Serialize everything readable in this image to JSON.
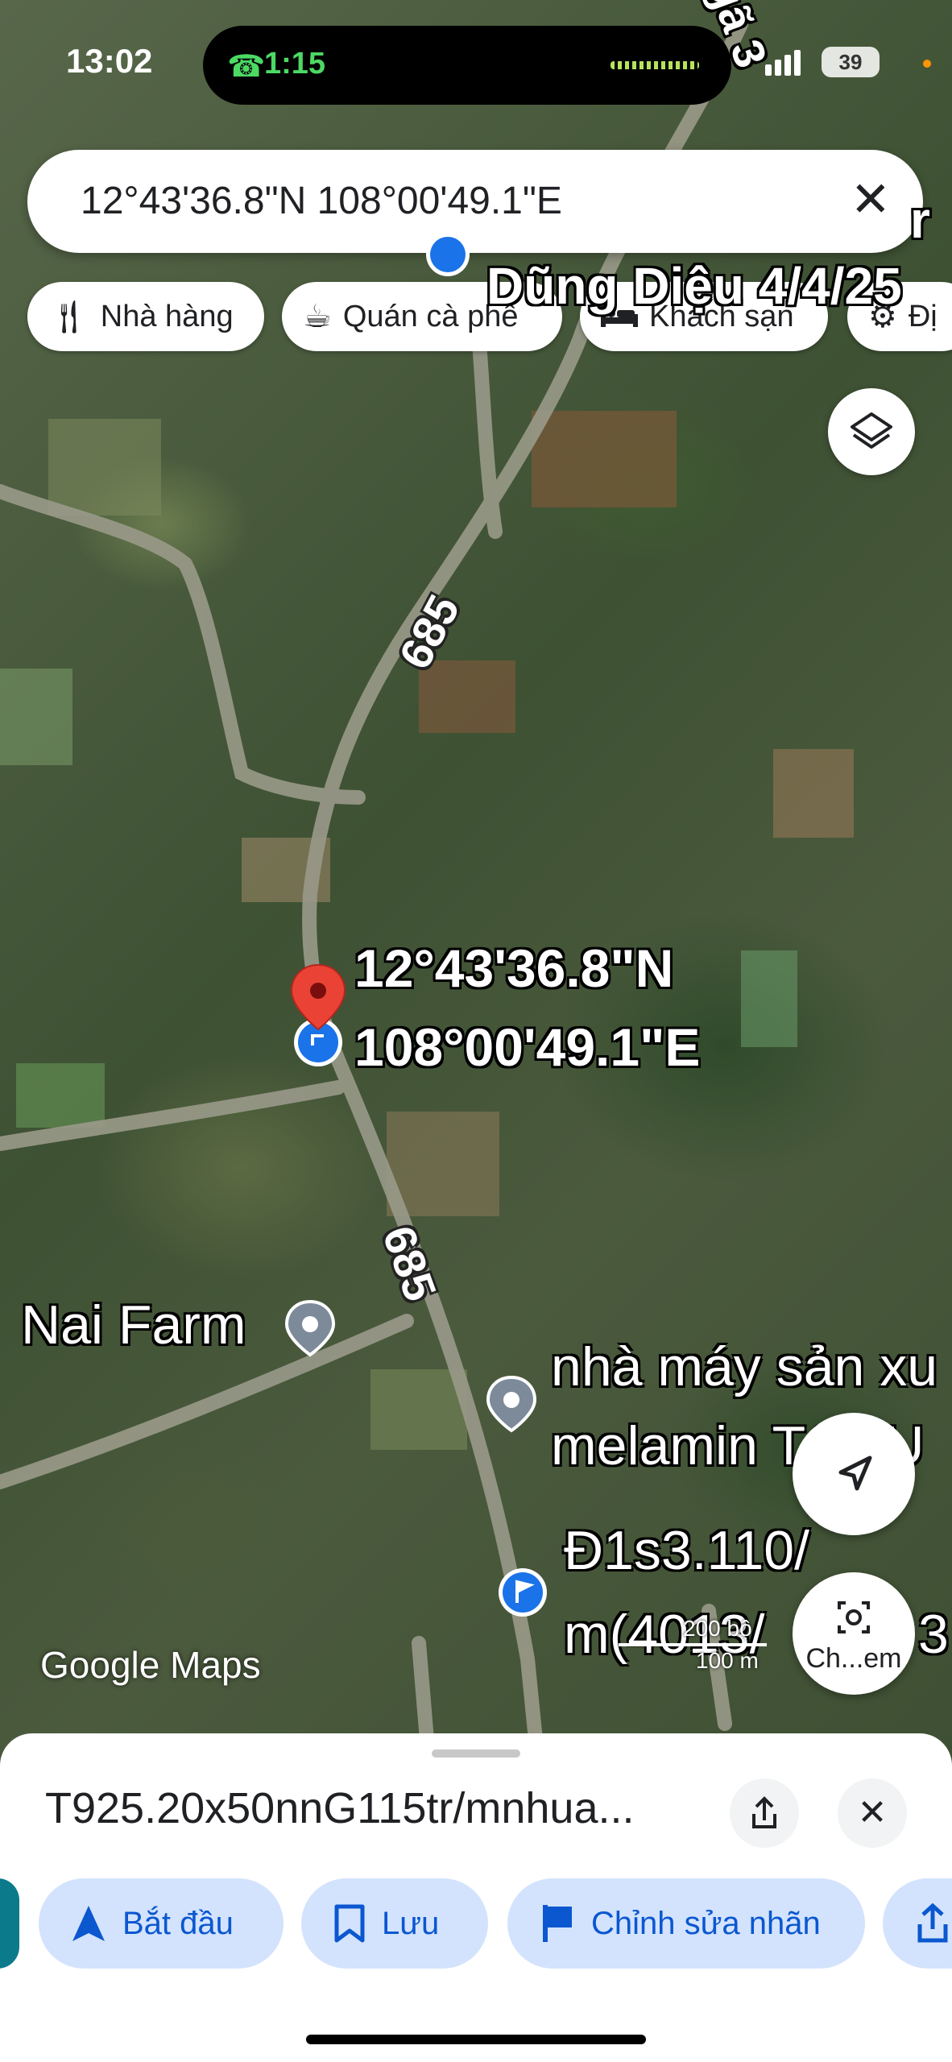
{
  "status_bar": {
    "time": "13:02",
    "call_time": "1:15",
    "battery": "39"
  },
  "search": {
    "value": "12°43'36.8\"N 108°00'49.1\"E"
  },
  "chips": [
    {
      "label": "Nhà hàng",
      "icon": "fork-knife-icon"
    },
    {
      "label": "Quán cà phê",
      "icon": "coffee-cup-icon"
    },
    {
      "label": "Khách sạn",
      "icon": "bed-icon"
    },
    {
      "label": "Đị",
      "icon": "attraction-icon"
    }
  ],
  "map": {
    "top_label_1": "gã 3",
    "top_label_2": "Dũng Diệu 4/4/25",
    "top_label_3": "r",
    "road_number": "685",
    "pin_lat": "12°43'36.8\"N",
    "pin_lng": "108°00'49.1\"E",
    "poi_1": "Nai Farm",
    "poi_2_line1": "nhà máy sản xu",
    "poi_2_line2": "melamin T&QU",
    "poi_3_line1": "Đ1s3.110/",
    "poi_3_line2": "m(4013/",
    "poi_3_extra": "3",
    "scale_top": "200 bộ",
    "scale_bottom": "100 m",
    "camera_label": "Ch...em",
    "google_logo": "Google Maps"
  },
  "sheet": {
    "title": "T925.20x50nnG115tr/mnhua...",
    "actions": [
      {
        "label": "Bắt đầu",
        "icon": "navigation-arrow-icon"
      },
      {
        "label": "Lưu",
        "icon": "bookmark-icon"
      },
      {
        "label": "Chỉnh sửa nhãn",
        "icon": "flag-icon"
      }
    ]
  },
  "colors": {
    "accent": "#0b57d0",
    "action_bg": "#d3e3fd",
    "pin": "#ea4335"
  }
}
